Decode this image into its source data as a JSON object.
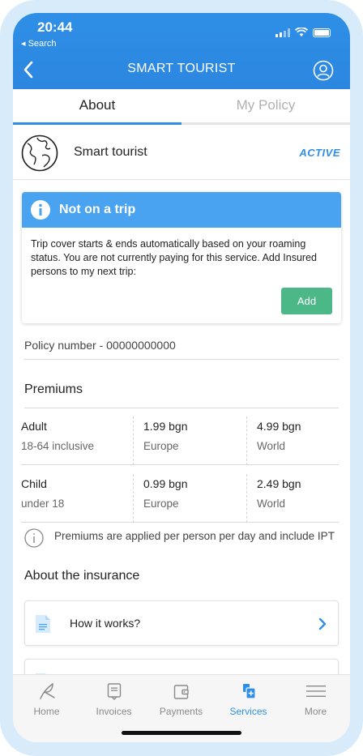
{
  "status_bar": {
    "time": "20:44",
    "back_app": "◂ Search"
  },
  "header": {
    "title": "SMART TOURIST"
  },
  "tabs": [
    {
      "label": "About",
      "active": true
    },
    {
      "label": "My Policy",
      "active": false
    }
  ],
  "service": {
    "name": "Smart tourist",
    "status": "ACTIVE"
  },
  "trip_card": {
    "title": "Not on a trip",
    "body": "Trip cover starts & ends automatically based on your roaming status. You are not currently paying for this service. Add Insured persons to my next trip:",
    "add_label": "Add"
  },
  "policy": {
    "text": "Policy number - 00000000000"
  },
  "premiums": {
    "title": "Premiums",
    "rows": [
      {
        "name": "Adult",
        "range": "18-64 inclusive",
        "europe_price": "1.99 bgn",
        "europe_label": "Europe",
        "world_price": "4.99 bgn",
        "world_label": "World"
      },
      {
        "name": "Child",
        "range": "under 18",
        "europe_price": "0.99 bgn",
        "europe_label": "Europe",
        "world_price": "2.49 bgn",
        "world_label": "World"
      }
    ],
    "note": "Premiums are applied per person per day and include IPT"
  },
  "about": {
    "title": "About the insurance",
    "items": [
      {
        "label": "How it works?"
      }
    ]
  },
  "tabbar": {
    "items": [
      {
        "label": "Home",
        "icon": "home-icon"
      },
      {
        "label": "Invoices",
        "icon": "invoice-icon"
      },
      {
        "label": "Payments",
        "icon": "wallet-icon"
      },
      {
        "label": "Services",
        "icon": "services-icon",
        "active": true
      },
      {
        "label": "More",
        "icon": "menu-icon"
      }
    ]
  },
  "colors": {
    "accent": "#2f8fe6",
    "card_header": "#4aa3f0",
    "add_button": "#4cb887"
  }
}
